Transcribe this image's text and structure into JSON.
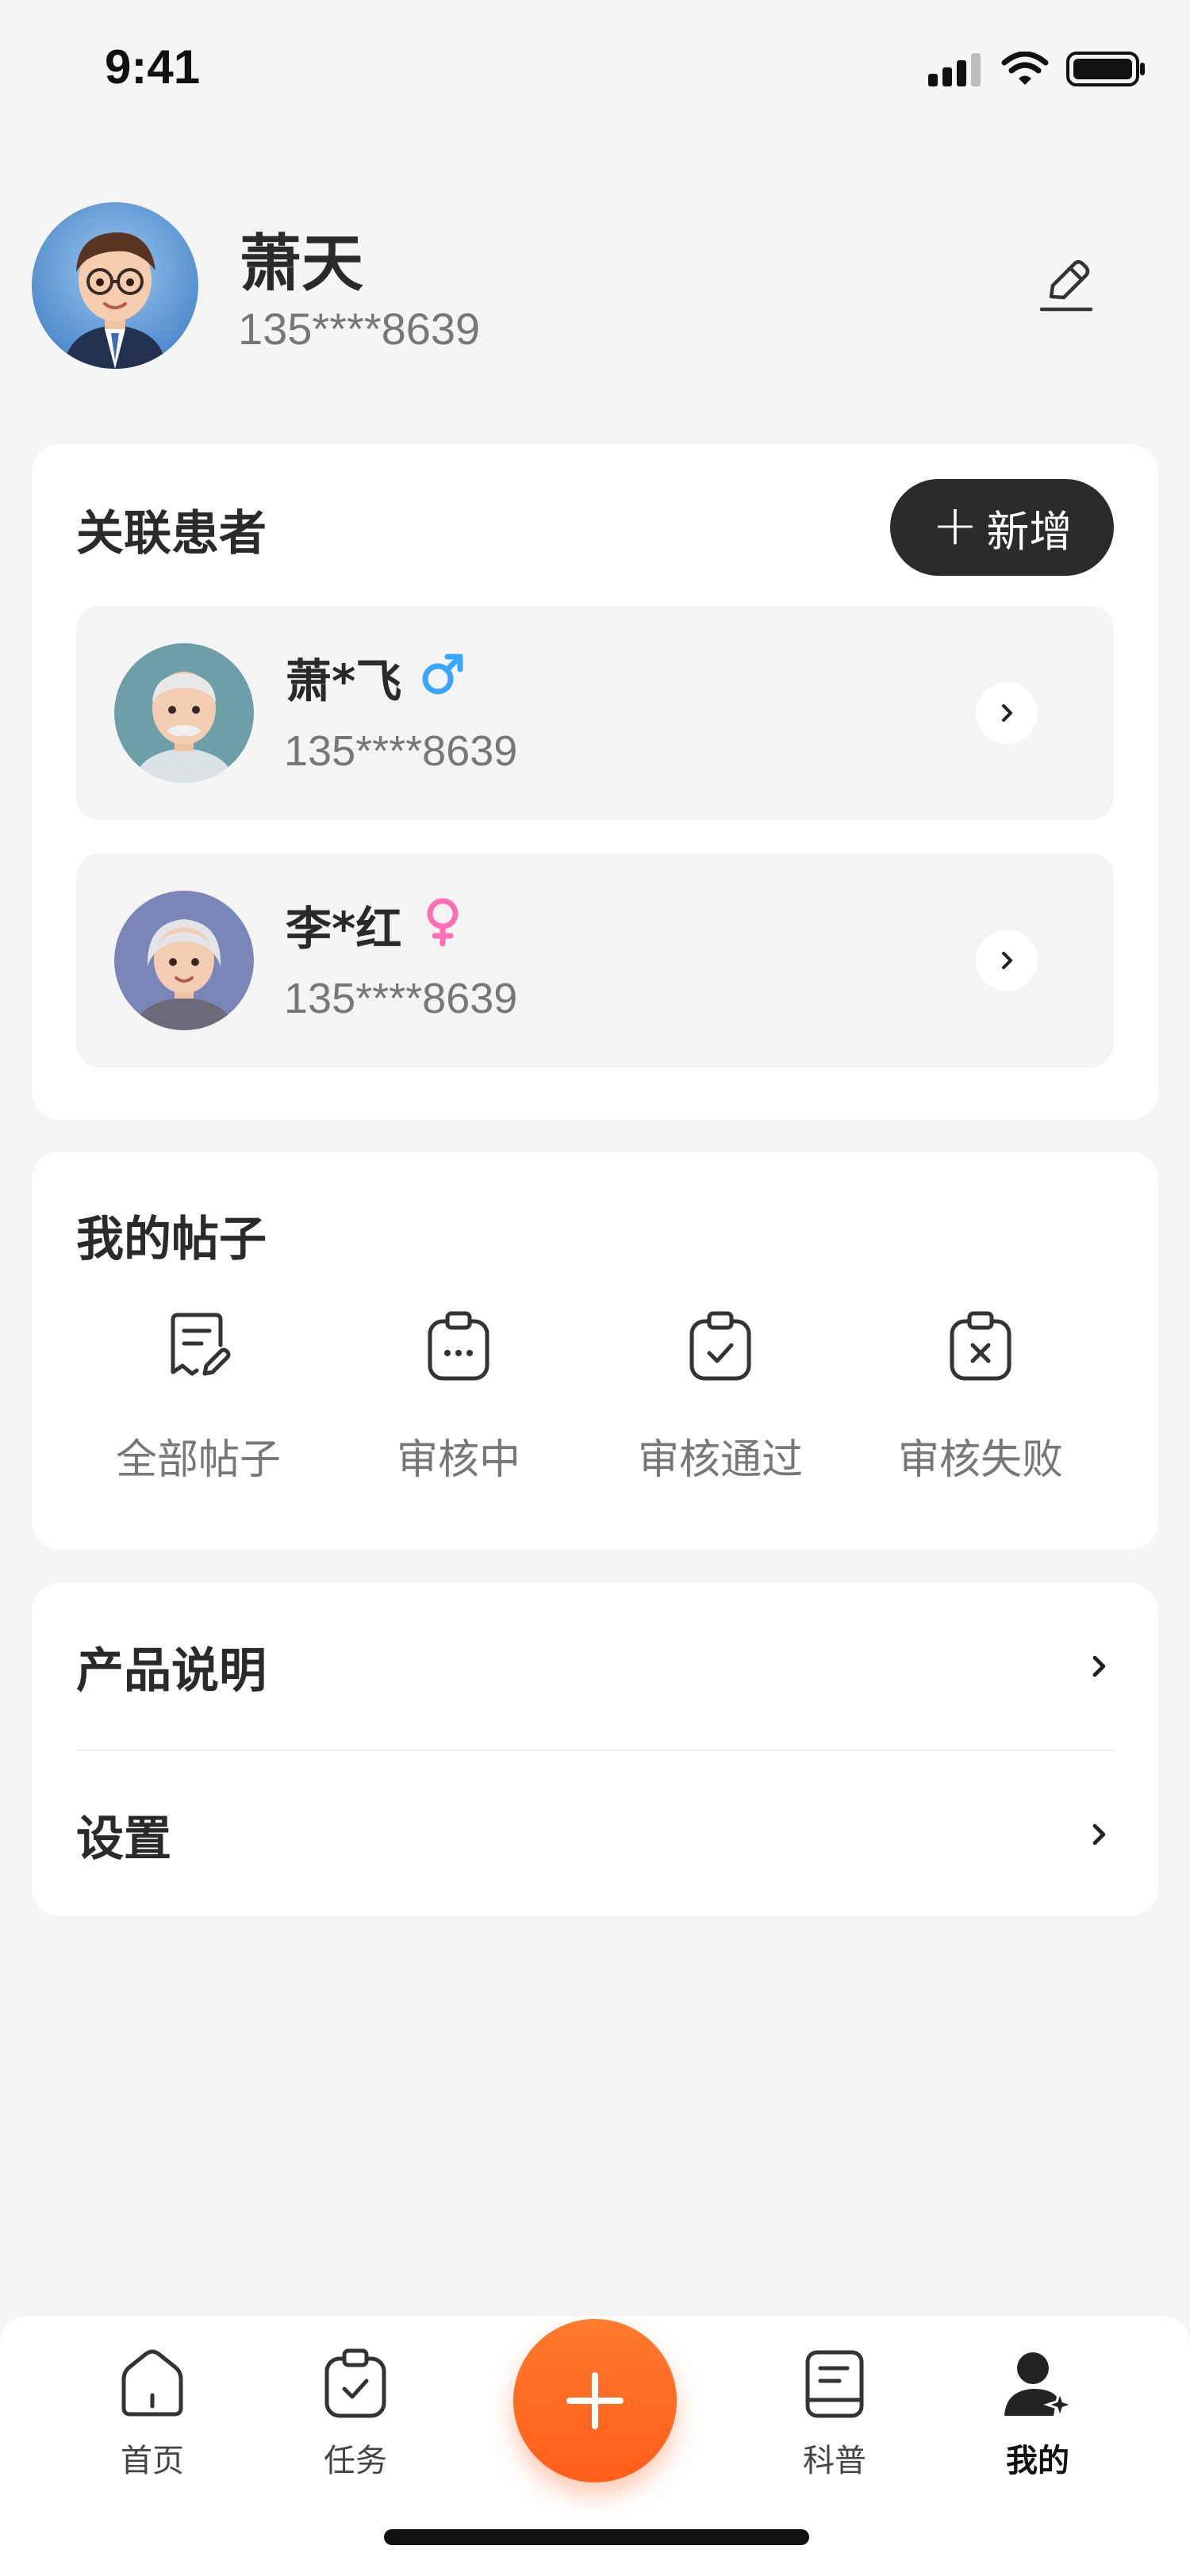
{
  "status_bar": {
    "time": "9:41"
  },
  "profile": {
    "name": "萧天",
    "phone": "135****8639",
    "avatar_icon": "boy-avatar",
    "edit_icon": "edit-pen-icon"
  },
  "patients": {
    "title": "关联患者",
    "add_label": "新增",
    "items": [
      {
        "name": "萧*飞",
        "phone": "135****8639",
        "gender_symbol": "♂",
        "gender": "male",
        "gender_color": "#3AA7FF"
      },
      {
        "name": "李*红",
        "phone": "135****8639",
        "gender_symbol": "♀",
        "gender": "female",
        "gender_color": "#FF6FB3"
      }
    ]
  },
  "posts": {
    "title": "我的帖子",
    "items": [
      {
        "label": "全部帖子",
        "icon": "post-edit-icon"
      },
      {
        "label": "审核中",
        "icon": "clipboard-pending-icon"
      },
      {
        "label": "审核通过",
        "icon": "clipboard-check-icon"
      },
      {
        "label": "审核失败",
        "icon": "clipboard-x-icon"
      }
    ]
  },
  "menu": {
    "items": [
      {
        "label": "产品说明"
      },
      {
        "label": "设置"
      }
    ]
  },
  "tabbar": {
    "items": [
      {
        "label": "首页",
        "icon": "home-icon"
      },
      {
        "label": "任务",
        "icon": "task-icon"
      },
      {
        "label": "科普",
        "icon": "book-icon"
      },
      {
        "label": "我的",
        "icon": "user-icon",
        "active": true
      }
    ],
    "fab_icon": "plus-icon",
    "fab_color": "#FF6A24"
  }
}
